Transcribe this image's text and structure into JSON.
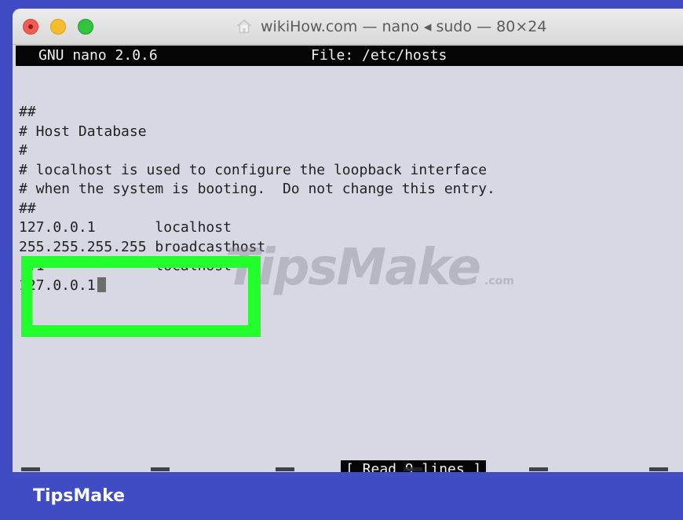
{
  "window": {
    "title": "wikiHow.com — nano ◂ sudo — 80×24",
    "title_icon": "home-icon"
  },
  "nano_header": {
    "version": "GNU nano 2.0.6",
    "file": "File: /etc/hosts"
  },
  "editor": {
    "lines": [
      "##",
      "# Host Database",
      "#",
      "# localhost is used to configure the loopback interface",
      "# when the system is booting.  Do not change this entry.",
      "##",
      "127.0.0.1       localhost",
      "255.255.255.255 broadcasthost",
      "::1             localhost",
      "127.0.0.1"
    ],
    "cursor_after_line_index": 9
  },
  "status": {
    "message": "[ Read 9 lines ]"
  },
  "watermark": {
    "main": "TipsMake",
    "suffix": ".com"
  },
  "footer": {
    "brand": "TipsMake"
  },
  "colors": {
    "outer_frame": "#3f4cc3",
    "terminal_background": "#d7d8e4",
    "highlight": "#23ff2c",
    "nano_bar": "#050505"
  }
}
